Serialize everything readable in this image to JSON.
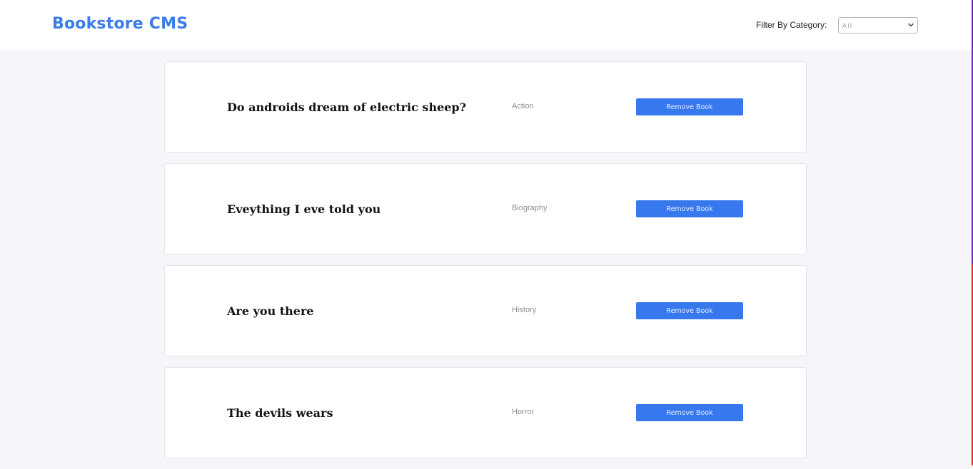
{
  "header": {
    "brand": "Bookstore CMS",
    "filter_label": "Filter By Category:",
    "filter_value": "All"
  },
  "books": [
    {
      "title": "Do androids dream of electric sheep?",
      "category": "Action",
      "remove_label": "Remove Book"
    },
    {
      "title": "Eveything I eve told you",
      "category": "Biography",
      "remove_label": "Remove Book"
    },
    {
      "title": "Are you there",
      "category": "History",
      "remove_label": "Remove Book"
    },
    {
      "title": "The devils wears",
      "category": "Horror",
      "remove_label": "Remove Book"
    }
  ],
  "colors": {
    "brand": "#3a7ce8",
    "button": "#3778ee",
    "background": "#f5f5fa"
  }
}
